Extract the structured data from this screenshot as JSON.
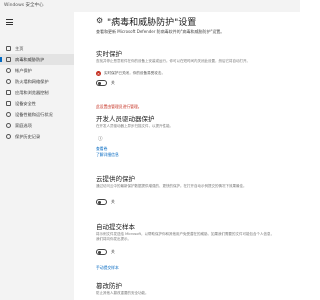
{
  "window": {
    "title": "Windows 安全中心"
  },
  "sidebar": {
    "items": [
      {
        "label": "主页",
        "icon": "home-icon"
      },
      {
        "label": "病毒和威胁防护",
        "icon": "shield-icon",
        "active": true
      },
      {
        "label": "帐户保护",
        "icon": "person-icon"
      },
      {
        "label": "防火墙和网络保护",
        "icon": "wifi-icon"
      },
      {
        "label": "应用和浏览器控制",
        "icon": "app-window-icon"
      },
      {
        "label": "设备安全性",
        "icon": "laptop-icon"
      },
      {
        "label": "设备性能和运行状况",
        "icon": "heart-icon"
      },
      {
        "label": "家庭选项",
        "icon": "family-icon"
      },
      {
        "label": "保护历史记录",
        "icon": "history-icon"
      }
    ]
  },
  "main": {
    "title": "\"病毒和威胁防护\"设置",
    "description": "查看和更新 Microsoft Defender 防病毒软件的\"病毒和威胁防护\"设置。",
    "realtime": {
      "title": "实时保护",
      "description": "查找并停止恶意软件在你的设备上安装或运行。你可以在短时间内关闭此设置，然后它将自动打开。",
      "warning": "实时保护已关闭，你的设备易受攻击。",
      "toggle_state": "关"
    },
    "red_note": "此设置由管理员进行管理。",
    "dev_drive": {
      "title": "开发人员驱动器保护",
      "description": "在开发人员驱动器上异步扫描文件，以提升性能。",
      "link1": "查看卷",
      "link2": "了解详细信息"
    },
    "cloud": {
      "title": "云提供的保护",
      "description": "通过访问云中的最新保护数据提供增强的、更快的保护。在打开自动示例提交的情况下效果最佳。",
      "toggle_state": "关"
    },
    "sample": {
      "title": "自动提交样本",
      "description": "将示例文件发送给 Microsoft，以帮助保护你和其他用户免受潜在的威胁。如果我们需要的文件可能包含个人信息，我们将向你发出提示。",
      "toggle_state": "关",
      "link": "手动提交样本"
    },
    "tamper": {
      "title": "篡改防护",
      "description": "防止其他人篡改重要的安全功能。"
    }
  }
}
